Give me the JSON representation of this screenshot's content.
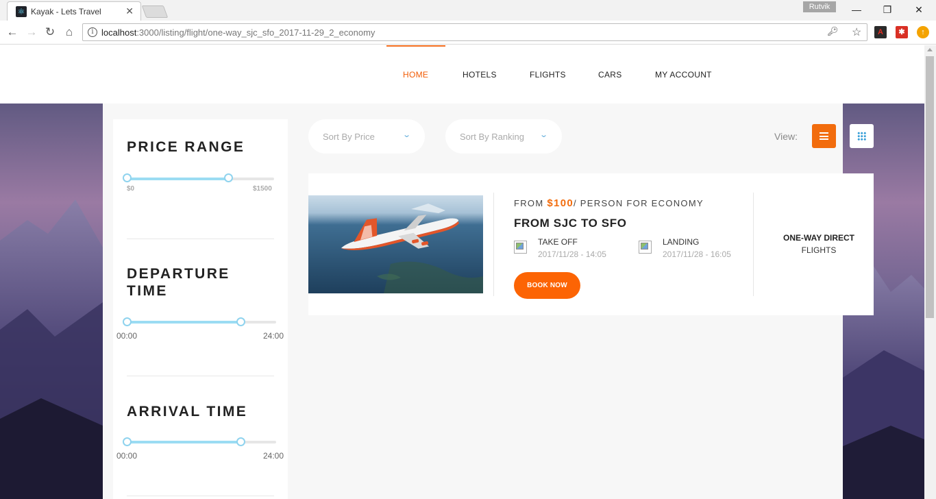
{
  "browser": {
    "tab_title": "Kayak - Lets Travel",
    "profile_name": "Rutvik",
    "url_host": "localhost",
    "url_rest": ":3000/listing/flight/one-way_sjc_sfo_2017-11-29_2_economy",
    "icons": [
      "back-icon",
      "forward-icon",
      "reload-icon",
      "home-icon",
      "info-icon",
      "key-icon",
      "star-icon"
    ],
    "extension_colors": [
      "#c00000",
      "#d93025",
      "#f4a300"
    ]
  },
  "nav": {
    "items": [
      {
        "label": "HOME",
        "active": true
      },
      {
        "label": "HOTELS",
        "active": false
      },
      {
        "label": "FLIGHTS",
        "active": false
      },
      {
        "label": "CARS",
        "active": false
      },
      {
        "label": "MY ACCOUNT",
        "active": false
      }
    ],
    "accent_color": "#f25c05"
  },
  "filters": {
    "price": {
      "title": "PRICE RANGE",
      "min_label": "$0",
      "max_label": "$1500",
      "low_fraction": 0.0,
      "high_fraction": 0.74
    },
    "departure": {
      "title_line1": "DEPARTURE",
      "title_line2": "TIME",
      "min_label": "00:00",
      "max_label": "24:00",
      "low_fraction": 0.0,
      "high_fraction": 0.83
    },
    "arrival": {
      "title": "ARRIVAL TIME",
      "min_label": "00:00",
      "max_label": "24:00",
      "low_fraction": 0.0,
      "high_fraction": 0.83
    }
  },
  "sort": {
    "price_label": "Sort By Price",
    "ranking_label": "Sort By Ranking",
    "view_label": "View:",
    "list_icon": "list-icon",
    "grid_icon": "grid-icon"
  },
  "result": {
    "from_label": "FROM",
    "price": "$100",
    "price_suffix": "/ PERSON FOR ECONOMY",
    "route": "FROM SJC TO SFO",
    "takeoff_label": "TAKE OFF",
    "takeoff_time": "2017/11/28 - 14:05",
    "landing_label": "LANDING",
    "landing_time": "2017/11/28 - 16:05",
    "book_label": "BOOK NOW",
    "flight_type": "ONE-WAY DIRECT",
    "flight_type_sub": "FLIGHTS",
    "button_color": "#fc6404"
  }
}
